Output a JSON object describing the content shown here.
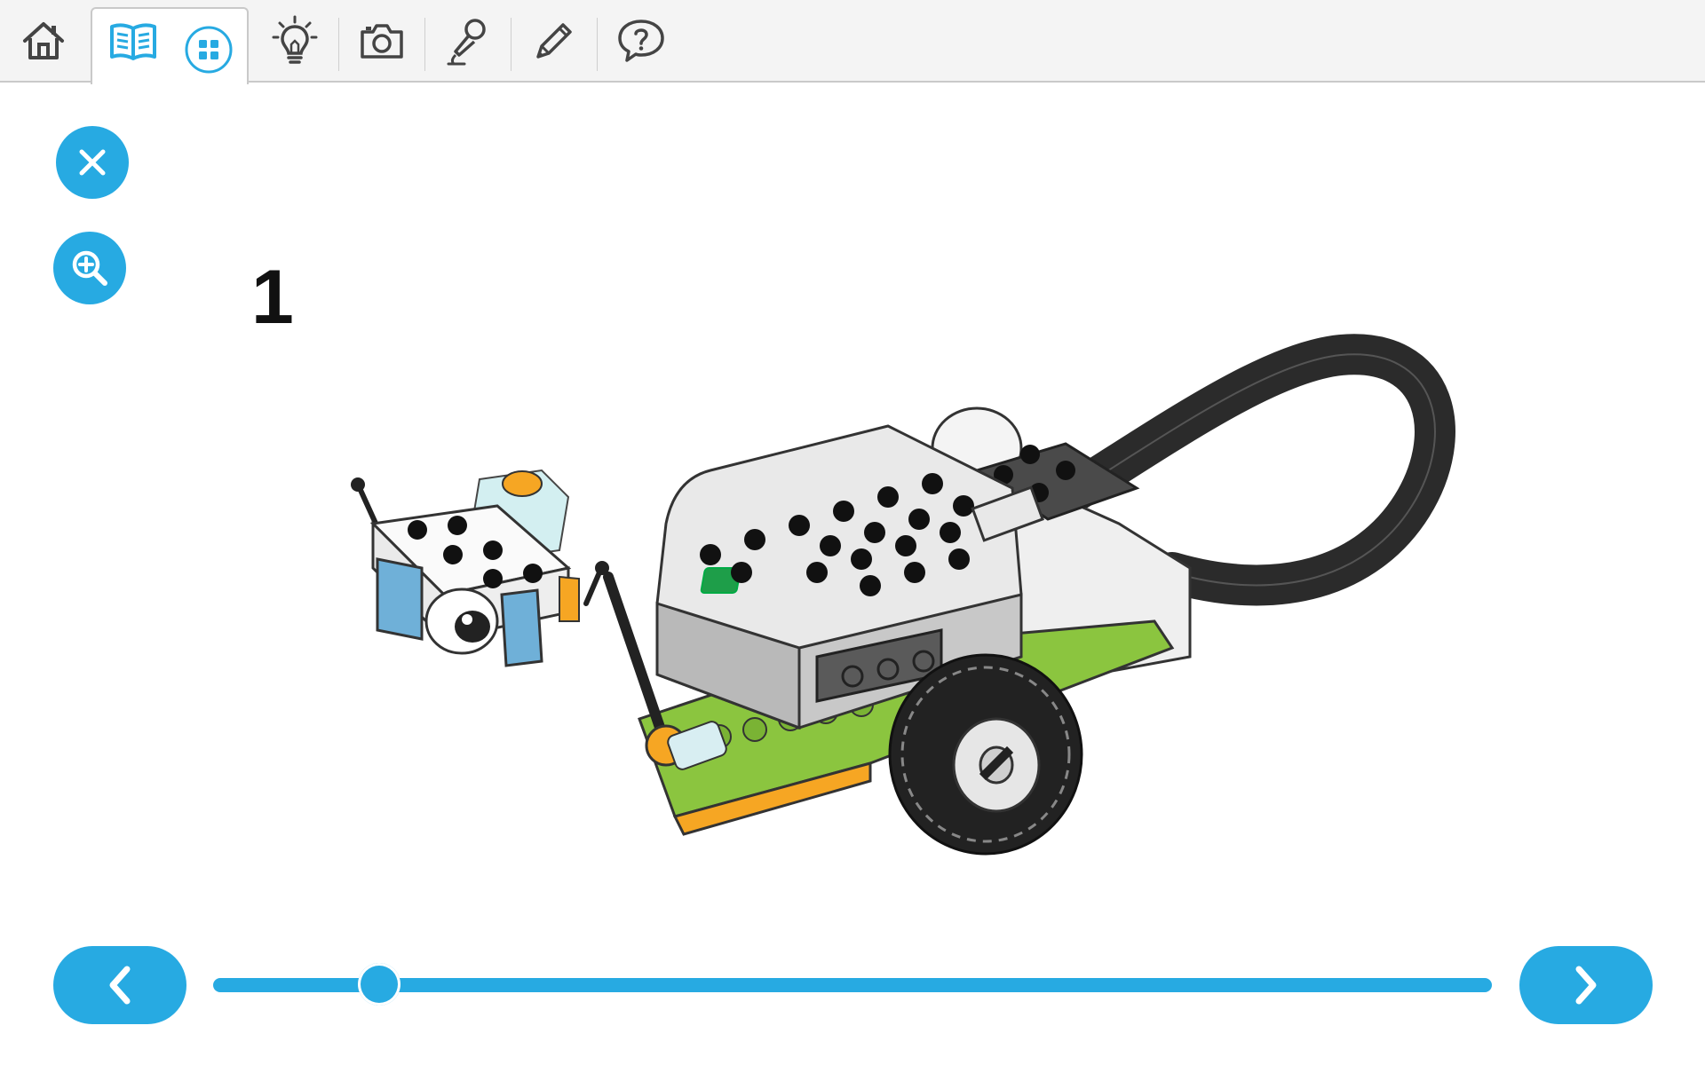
{
  "toolbar": {
    "items": [
      {
        "icon": "home-icon"
      },
      {
        "icon": "book-icon",
        "active": true
      },
      {
        "icon": "grid-icon",
        "active": true
      },
      {
        "icon": "lightbulb-icon"
      },
      {
        "icon": "camera-icon"
      },
      {
        "icon": "microphone-icon"
      },
      {
        "icon": "pencil-icon"
      },
      {
        "icon": "help-bubble-icon"
      }
    ]
  },
  "instructions": {
    "step_number": "1",
    "progress_fraction": 0.13
  },
  "colors": {
    "accent": "#27aae2",
    "toolbar_bg": "#f4f4f4",
    "icon_dark": "#444444"
  }
}
